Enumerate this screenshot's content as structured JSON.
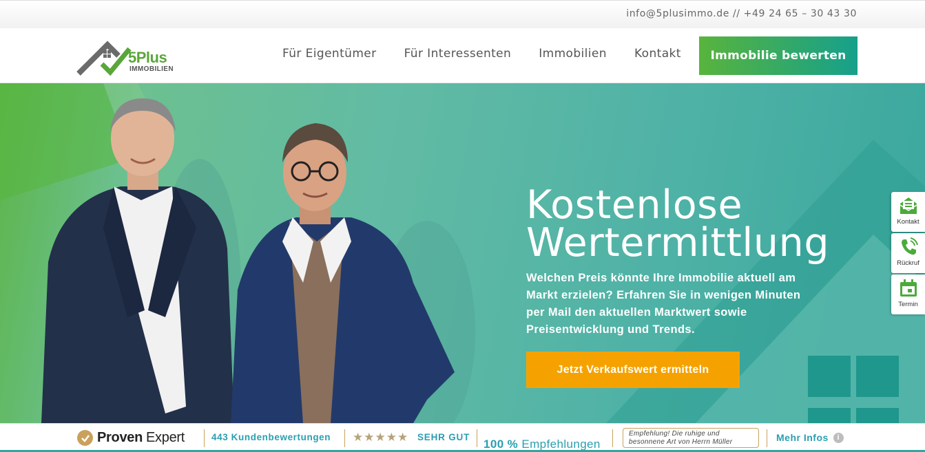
{
  "topbar": {
    "contact": "info@5plusimmo.de // +49 24 65 – 30 43 30"
  },
  "logo": {
    "main": "5Plus",
    "sub": "IMMOBILIEN"
  },
  "nav": {
    "items": [
      {
        "label": "Für Eigentümer"
      },
      {
        "label": "Für Interessenten"
      },
      {
        "label": "Immobilien"
      },
      {
        "label": "Kontakt"
      }
    ],
    "cta": "Immobilie bewerten"
  },
  "hero": {
    "title_line1": "Kostenlose",
    "title_line2": "Wertermittlung",
    "lead": "Welchen Preis könnte Ihre Immobilie aktuell am Markt erzielen? Erfahren Sie in wenigen Minuten per Mail den aktuellen Marktwert sowie Preisentwicklung und Trends.",
    "cta": "Jetzt Verkaufswert ermitteln"
  },
  "side_widget": {
    "items": [
      {
        "label": "Kontakt",
        "icon": "mail-icon"
      },
      {
        "label": "Rückruf",
        "icon": "phone-icon"
      },
      {
        "label": "Termin",
        "icon": "calendar-icon"
      }
    ]
  },
  "proofbar": {
    "brand_bold": "Proven",
    "brand_light": "Expert",
    "reviews": "443 Kundenbewertungen",
    "stars": "★★★★★",
    "rating_value": 4.5,
    "rating_text": "SEHR GUT",
    "recommend_pct": "100 %",
    "recommend_label": "Empfehlungen",
    "quote_line1": "Empfehlung! Die ruhige und",
    "quote_line2": "besonnene Art von Herrn Müller",
    "more": "Mehr Infos",
    "info_glyph": "i"
  },
  "colors": {
    "green": "#5aa63a",
    "teal": "#2a9fb0",
    "orange": "#f5a200",
    "gold": "#c9a15c"
  }
}
